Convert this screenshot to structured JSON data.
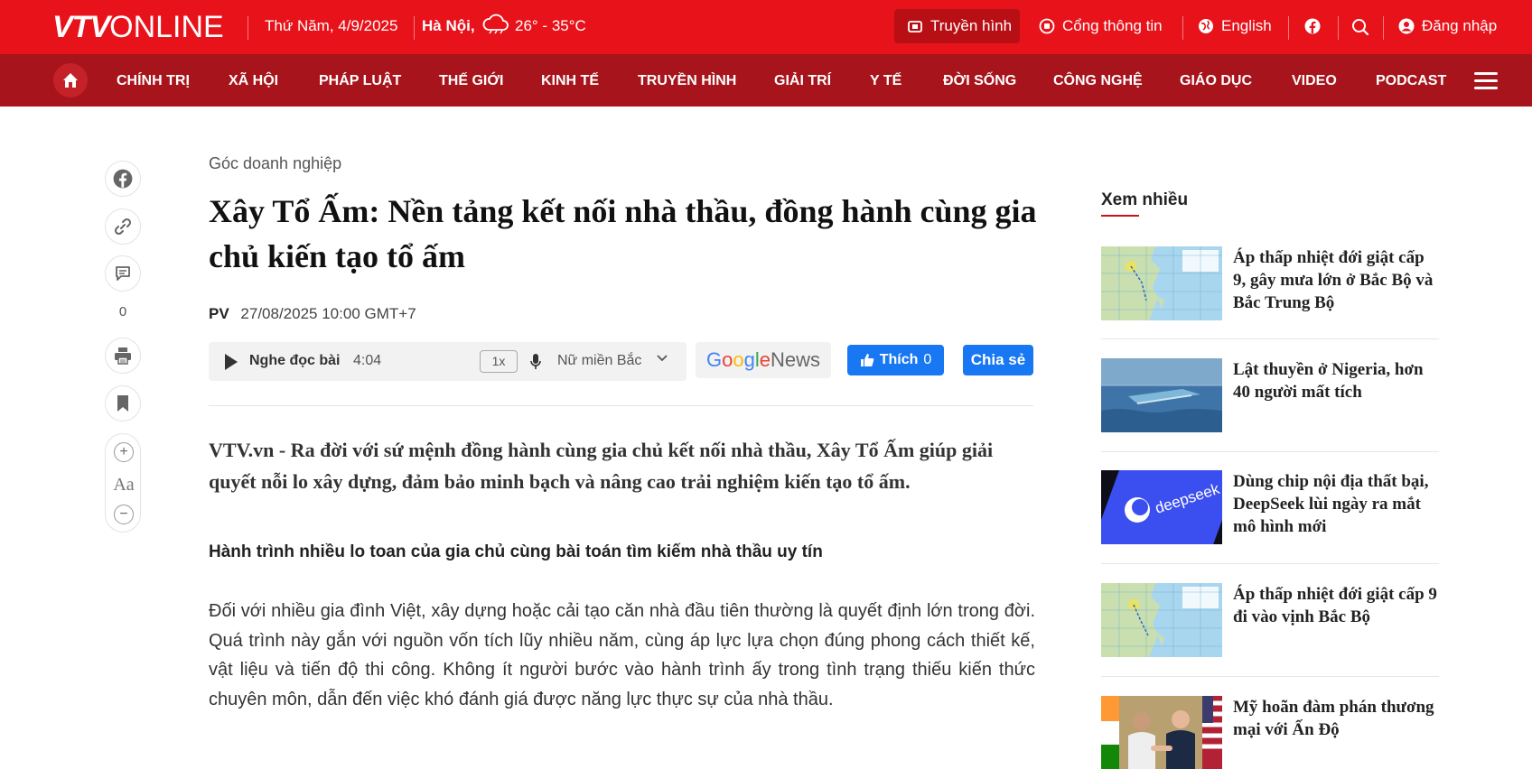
{
  "topbar": {
    "logo_vtv": "VTV",
    "logo_online": "ONLINE",
    "date": "Thứ Năm, 4/9/2025",
    "city": "Hà Nội,",
    "temperature": "26° - 35°C",
    "tv_label": "Truyền hình",
    "portal_label": "Cổng thông tin",
    "language_label": "English",
    "login_label": "Đăng nhập"
  },
  "nav": {
    "items": [
      "CHÍNH TRỊ",
      "XÃ HỘI",
      "PHÁP LUẬT",
      "THẾ GIỚI",
      "KINH TẾ",
      "TRUYỀN HÌNH",
      "GIẢI TRÍ",
      "Y TẾ",
      "ĐỜI SỐNG",
      "CÔNG NGHỆ",
      "GIÁO DỤC",
      "VIDEO",
      "PODCAST"
    ]
  },
  "social": {
    "comment_count": "0",
    "font_label": "Aa",
    "plus": "+",
    "minus": "−"
  },
  "article": {
    "breadcrumb": "Góc doanh nghiệp",
    "title": "Xây Tổ Ấm: Nền tảng kết nối nhà thầu, đồng hành cùng gia chủ kiến tạo tổ ấm",
    "author": "PV",
    "datetime": "27/08/2025 10:00 GMT+7",
    "audio": {
      "label": "Nghe đọc bài",
      "duration": "4:04",
      "speed": "1x",
      "voice": "Nữ miền Bắc"
    },
    "gnews": {
      "g": "G",
      "o1": "o",
      "o2": "o",
      "g2": "g",
      "l": "l",
      "e": "e",
      "news": " News"
    },
    "like_label": "Thích",
    "like_count": "0",
    "share_label": "Chia sẻ",
    "sapo": "VTV.vn - Ra đời với sứ mệnh đồng hành cùng gia chủ kết nối nhà thầu, Xây Tổ Ấm giúp giải quyết nỗi lo xây dựng, đảm bảo minh bạch và nâng cao trải nghiệm kiến tạo tổ ấm.",
    "subhead": "Hành trình nhiều lo toan của gia chủ cùng bài toán tìm kiếm nhà thầu uy tín",
    "paragraph": "Đối với nhiều gia đình Việt, xây dựng hoặc cải tạo căn nhà đầu tiên thường là quyết định lớn trong đời. Quá trình này gắn với nguồn vốn tích lũy nhiều năm, cùng áp lực lựa chọn đúng phong cách thiết kế, vật liệu và tiến độ thi công. Không ít người bước vào hành trình ấy trong tình trạng thiếu kiến thức chuyên môn, dẫn đến việc khó đánh giá được năng lực thực sự của nhà thầu."
  },
  "sidebar": {
    "title": "Xem nhiều",
    "items": [
      {
        "title": "Áp thấp nhiệt đới giật cấp 9, gây mưa lớn ở Bắc Bộ và Bắc Trung Bộ",
        "thumb": "weather-map"
      },
      {
        "title": "Lật thuyền ở Nigeria, hơn 40 người mất tích",
        "thumb": "capsized-boat"
      },
      {
        "title": "Dùng chip nội địa thất bại, DeepSeek lùi ngày ra mắt mô hình mới",
        "thumb": "deepseek-logo",
        "thumb_text": "deepseek"
      },
      {
        "title": "Áp thấp nhiệt đới giật cấp 9 đi vào vịnh Bắc Bộ",
        "thumb": "weather-map"
      },
      {
        "title": "Mỹ hoãn đàm phán thương mại với Ấn Độ",
        "thumb": "handshake-flags"
      }
    ]
  },
  "colors": {
    "topbar": "#e8121a",
    "nav": "#a8141b",
    "facebook": "#1877f2"
  }
}
